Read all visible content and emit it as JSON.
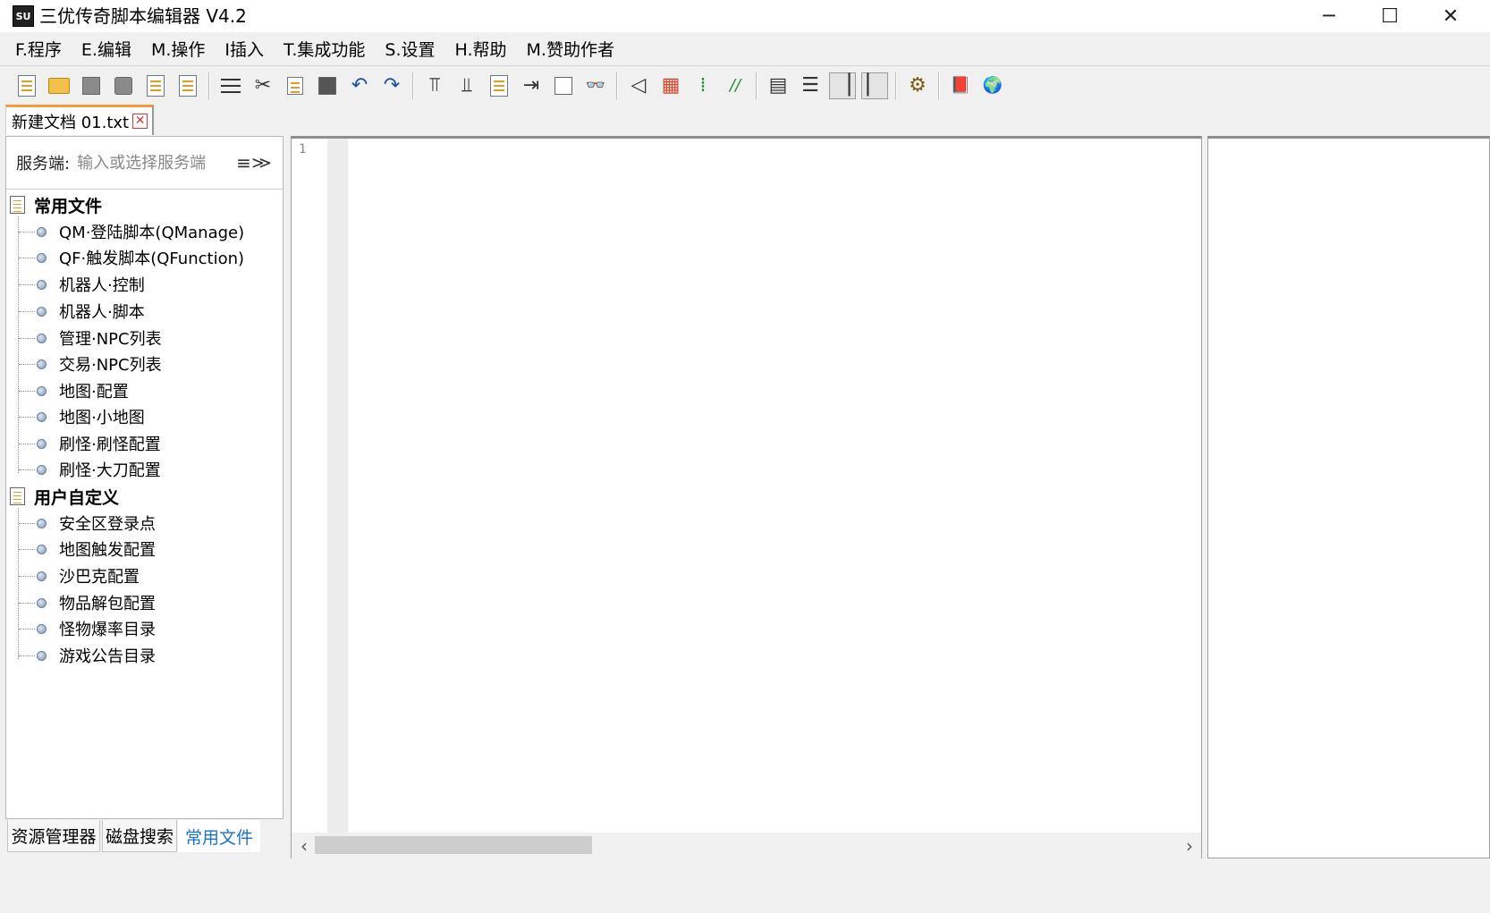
{
  "app": {
    "title": "三优传奇脚本编辑器 V4.2",
    "icon_text": "SU",
    "window_controls": {
      "minimize": "─",
      "maximize": "☐",
      "close": "✕"
    }
  },
  "menu": [
    {
      "label": "F.程序"
    },
    {
      "label": "E.编辑"
    },
    {
      "label": "M.操作"
    },
    {
      "label": "I插入"
    },
    {
      "label": "T.集成功能"
    },
    {
      "label": "S.设置"
    },
    {
      "label": "H.帮助"
    },
    {
      "label": "M.赞助作者"
    }
  ],
  "toolbar": {
    "glyphs": {
      "cut": "✂",
      "undo": "↶",
      "redo": "↷",
      "align_top": "⫪",
      "align_bottom": "⫫",
      "indent": "⇥",
      "binoculars": "👓",
      "arrow_left": "◁",
      "grid": "▦",
      "comment": "⁞",
      "uncomment": "//",
      "wrap": "▤",
      "list": "☰",
      "col_left": "▕",
      "col_right": "▏",
      "settings": "⚙",
      "book": "📕",
      "globe": "🌍"
    }
  },
  "document_tab": {
    "label": "新建文档 01.txt",
    "close_glyph": "✕"
  },
  "server": {
    "label": "服务端:",
    "placeholder": "输入或选择服务端",
    "menu_glyph": "≡",
    "chevron_glyph": "≫"
  },
  "tree": {
    "groups": [
      {
        "label": "常用文件",
        "items": [
          "QM·登陆脚本(QManage)",
          "QF·触发脚本(QFunction)",
          "机器人·控制",
          "机器人·脚本",
          "管理·NPC列表",
          "交易·NPC列表",
          "地图·配置",
          "地图·小地图",
          "刷怪·刷怪配置",
          "刷怪·大刀配置"
        ]
      },
      {
        "label": "用户自定义",
        "items": [
          "安全区登录点",
          "地图触发配置",
          "沙巴克配置",
          "物品解包配置",
          "怪物爆率目录",
          "游戏公告目录"
        ]
      }
    ]
  },
  "bottom_tabs": [
    {
      "label": "资源管理器",
      "active": false
    },
    {
      "label": "磁盘搜索",
      "active": false
    },
    {
      "label": "常用文件",
      "active": true
    }
  ],
  "editor": {
    "line_numbers": [
      "1"
    ],
    "scroll_left": "‹",
    "scroll_right": "›"
  },
  "colors": {
    "tab_accent": "#f39c3c",
    "active_tab_text": "#1a73c9",
    "close_red": "#d43a3a"
  }
}
